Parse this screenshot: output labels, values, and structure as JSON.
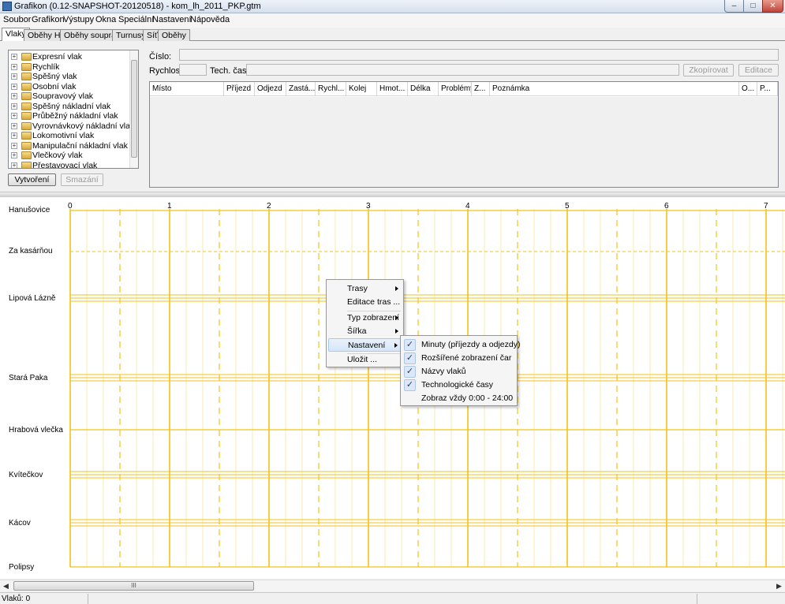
{
  "window": {
    "title": "Grafikon (0.12-SNAPSHOT-20120518) - kom_lh_2011_PKP.gtm",
    "min": "–",
    "max": "□",
    "close": "✕"
  },
  "menubar": [
    "Soubor",
    "Grafikon",
    "Výstupy",
    "Okna",
    "Speciální",
    "Nastavení",
    "Nápověda"
  ],
  "tabs": [
    "Vlaky",
    "Oběhy HV",
    "Oběhy souprav",
    "Turnusy",
    "Síť",
    "Oběhy"
  ],
  "active_tab": "Vlaky",
  "train_types": [
    "Expresní vlak",
    "Rychlík",
    "Spěšný vlak",
    "Osobní vlak",
    "Soupravový vlak",
    "Spěšný nákladní vlak",
    "Průběžný nákladní vlak",
    "Vyrovnávkový nákladní vlak",
    "Lokomotivní vlak",
    "Manipulační nákladní vlak",
    "Vlečkový vlak",
    "Přestavovací vlak"
  ],
  "buttons": {
    "create": "Vytvoření",
    "delete": "Smazání",
    "copy": "Zkopírovat",
    "edit": "Editace"
  },
  "form": {
    "number_label": "Číslo:",
    "speed_label": "Rychlost:",
    "tech_times_label": "Tech. časy:"
  },
  "table_columns": [
    "Místo",
    "Příjezd",
    "Odjezd",
    "Zastá...",
    "Rychl...",
    "Kolej",
    "Hmot...",
    "Délka",
    "Problémy",
    "Z...",
    "Poznámka",
    "O...",
    "P..."
  ],
  "graph": {
    "hours": [
      "0",
      "1",
      "2",
      "3",
      "4",
      "5",
      "6",
      "7"
    ],
    "stations": [
      "Hanušovice",
      "Za kasárňou",
      "Lipová Lázně",
      "Stará Paka",
      "Hrabová vlečka",
      "Kvítečkov",
      "Kácov",
      "Polipsy"
    ],
    "line_color": "#f2c318"
  },
  "context_menu": {
    "items": [
      "Trasy",
      "Editace tras ...",
      "Typ zobrazení",
      "Šířka",
      "Nastavení",
      "Uložit ..."
    ],
    "highlighted": "Nastavení"
  },
  "submenu": {
    "items": [
      {
        "label": "Minuty (příjezdy a odjezdy)",
        "checked": true
      },
      {
        "label": "Rozšířené zobrazení čar",
        "checked": true
      },
      {
        "label": "Názvy vlaků",
        "checked": true
      },
      {
        "label": "Technologické časy",
        "checked": true
      },
      {
        "label": "Zobraz vždy 0:00 - 24:00",
        "checked": false
      }
    ]
  },
  "hscroll_grip": "III",
  "status": {
    "text": "Vlaků: 0"
  }
}
